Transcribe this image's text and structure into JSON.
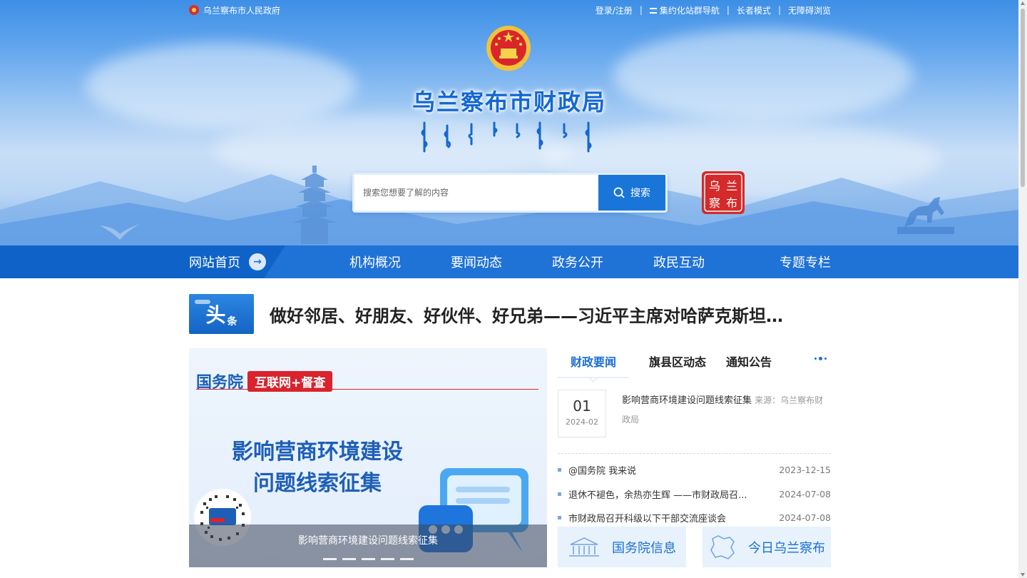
{
  "topbar": {
    "site_name": "乌兰察布市人民政府",
    "links": [
      "登录/注册",
      "集约化站群导航",
      "长者模式",
      "无障碍浏览"
    ],
    "separator": "|"
  },
  "header": {
    "title": "乌兰察布市财政局",
    "seal_chars": [
      "乌",
      "兰",
      "察",
      "布"
    ]
  },
  "search": {
    "placeholder": "搜索您想要了解的内容",
    "button_label": "搜索"
  },
  "nav": {
    "home": "网站首页",
    "items": [
      "机构概况",
      "要闻动态",
      "政务公开",
      "政民互动",
      "专题专栏"
    ]
  },
  "headline": {
    "badge_big": "头",
    "badge_small": "条",
    "text": "做好邻居、好朋友、好伙伴、好兄弟——习近平主席对哈萨克斯坦…"
  },
  "slider": {
    "brand": "国务院",
    "brand_tag": "互联网+督查",
    "heading_line1": "影响营商环境建设",
    "heading_line2": "问题线索征集",
    "caption": "影响营商环境建设问题线索征集",
    "dot_count": 5
  },
  "news": {
    "tabs": [
      "财政要闻",
      "旗县区动态",
      "通知公告"
    ],
    "active_tab": 0,
    "featured": {
      "day": "01",
      "year_month": "2024-02",
      "title": "影响营商环境建设问题线索征集",
      "source_label": "来源：乌兰察布财政局"
    },
    "list": [
      {
        "title": "@国务院 我来说",
        "date": "2023-12-15"
      },
      {
        "title": "退休不褪色，余热亦生辉 ——市财政局召...",
        "date": "2024-07-08"
      },
      {
        "title": "市财政局召开科级以下干部交流座谈会",
        "date": "2024-07-08"
      }
    ]
  },
  "quick_links": [
    {
      "label": "国务院信息",
      "icon": "building-icon"
    },
    {
      "label": "今日乌兰察布",
      "icon": "map-icon"
    }
  ],
  "colors": {
    "primary": "#1f72d6",
    "accent_red": "#d9232d",
    "title_blue": "#1468d2"
  }
}
